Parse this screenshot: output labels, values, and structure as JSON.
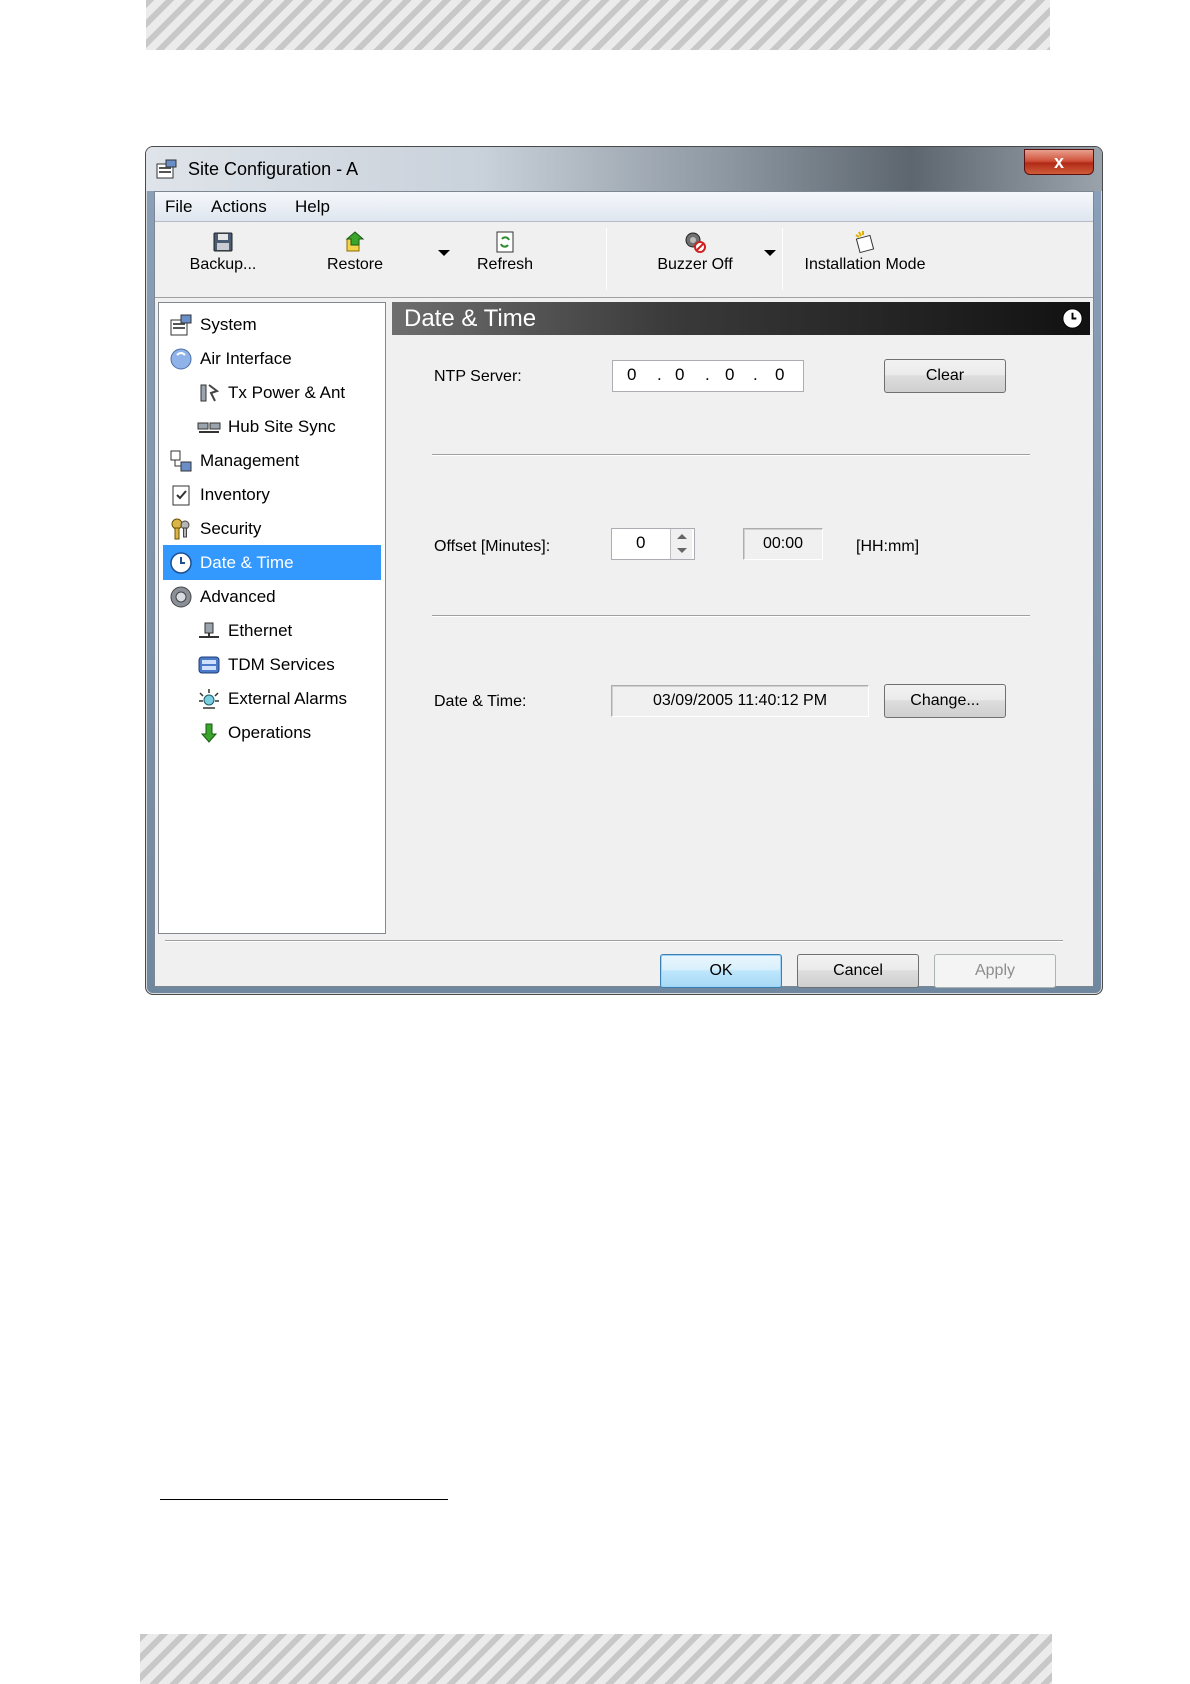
{
  "window": {
    "title": "Site Configuration - A",
    "close_label": "x"
  },
  "menu": {
    "file": "File",
    "actions": "Actions",
    "help": "Help"
  },
  "toolbar": {
    "backup": "Backup...",
    "restore": "Restore",
    "refresh": "Refresh",
    "buzzer_off": "Buzzer Off",
    "installation_mode": "Installation Mode"
  },
  "tree": {
    "items": [
      {
        "label": "System",
        "icon": "system-icon"
      },
      {
        "label": "Air Interface",
        "icon": "air-interface-icon"
      },
      {
        "label": "Tx Power & Ant",
        "icon": "tx-power-icon"
      },
      {
        "label": "Hub Site Sync",
        "icon": "hub-site-sync-icon"
      },
      {
        "label": "Management",
        "icon": "management-icon"
      },
      {
        "label": "Inventory",
        "icon": "inventory-icon"
      },
      {
        "label": "Security",
        "icon": "security-icon"
      },
      {
        "label": "Date & Time",
        "icon": "clock-icon",
        "selected": true
      },
      {
        "label": "Advanced",
        "icon": "gear-icon"
      },
      {
        "label": "Ethernet",
        "icon": "ethernet-icon"
      },
      {
        "label": "TDM Services",
        "icon": "tdm-services-icon"
      },
      {
        "label": "External Alarms",
        "icon": "alarm-icon"
      },
      {
        "label": "Operations",
        "icon": "operations-icon"
      }
    ]
  },
  "content": {
    "header": "Date & Time",
    "ntp": {
      "label": "NTP Server:",
      "octets": [
        "0",
        "0",
        "0",
        "0"
      ],
      "clear_label": "Clear"
    },
    "offset": {
      "label": "Offset [Minutes]:",
      "value": "0",
      "hhmm_value": "00:00",
      "unit": "[HH:mm]"
    },
    "datetime": {
      "label": "Date & Time:",
      "value": "03/09/2005 11:40:12 PM",
      "change_label": "Change..."
    }
  },
  "dialog_buttons": {
    "ok": "OK",
    "cancel": "Cancel",
    "apply": "Apply"
  },
  "colors": {
    "selection": "#3399ff",
    "header_bg": "#111111"
  }
}
